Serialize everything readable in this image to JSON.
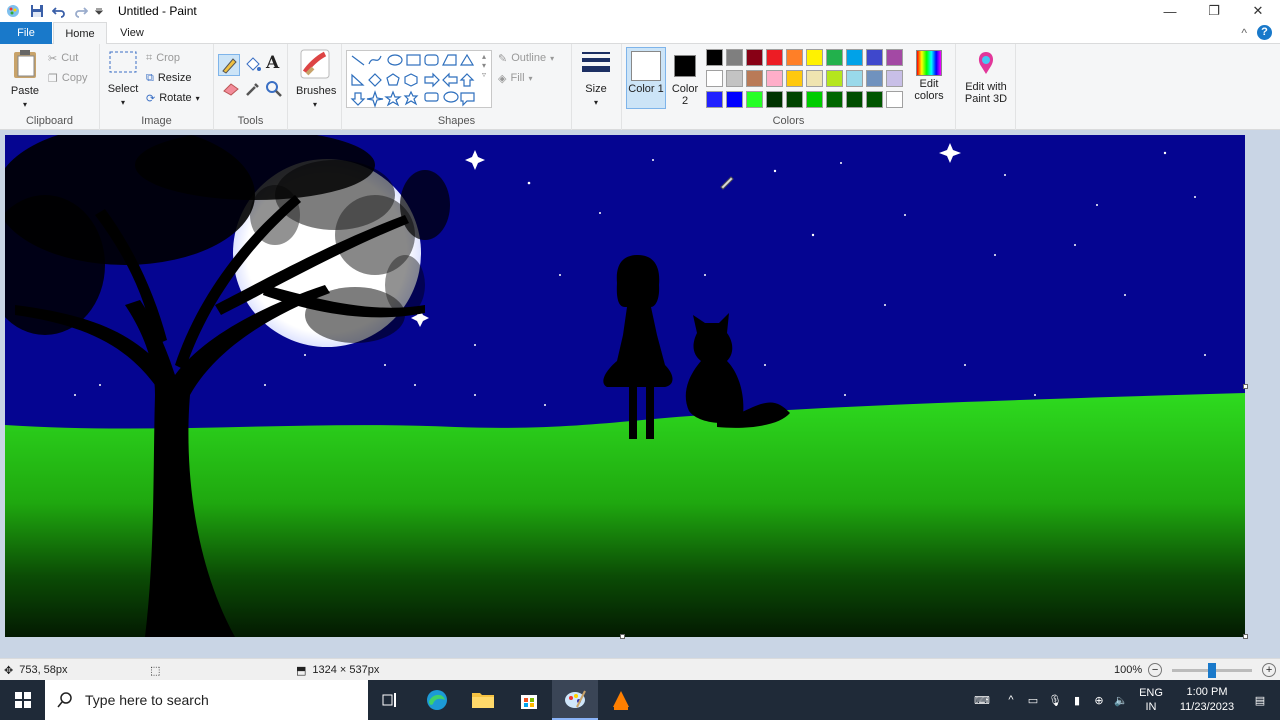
{
  "window": {
    "title": "Untitled - Paint",
    "minimize": "—",
    "restore": "❐",
    "close": "✕"
  },
  "tabs": {
    "file": "File",
    "home": "Home",
    "view": "View",
    "collapse": "^",
    "help": "?"
  },
  "ribbon": {
    "clipboard": {
      "label": "Clipboard",
      "paste": "Paste",
      "cut": "Cut",
      "copy": "Copy"
    },
    "image": {
      "label": "Image",
      "select": "Select",
      "crop": "Crop",
      "resize": "Resize",
      "rotate": "Rotate"
    },
    "tools": {
      "label": "Tools"
    },
    "brushes": {
      "label": "Brushes"
    },
    "shapes": {
      "label": "Shapes",
      "outline": "Outline",
      "fill": "Fill"
    },
    "size": {
      "label": "Size"
    },
    "colors": {
      "label": "Colors",
      "color1": "Color 1",
      "color2": "Color 2",
      "color1_value": "#ffffff",
      "color2_value": "#000000",
      "edit_colors": "Edit colors",
      "edit_3d": "Edit with Paint 3D",
      "palette_row1": [
        "#000000",
        "#7f7f7f",
        "#880015",
        "#ed1c24",
        "#ff7f27",
        "#fff200",
        "#22b14c",
        "#00a2e8",
        "#3f48cc",
        "#a349a4"
      ],
      "palette_row2": [
        "#ffffff",
        "#c3c3c3",
        "#b97a57",
        "#ffaec9",
        "#ffc90e",
        "#efe4b0",
        "#b5e61d",
        "#99d9ea",
        "#7092be",
        "#c8bfe7"
      ],
      "palette_row3": [
        "#2121ff",
        "#0000ff",
        "#26ff26",
        "#003300",
        "#004400",
        "#00cc00",
        "#006600",
        "#004d00",
        "#005500",
        "#ffffff"
      ]
    }
  },
  "status": {
    "cursor_pos": "753, 58px",
    "canvas_size": "1324 × 537px",
    "zoom": "100%"
  },
  "taskbar": {
    "search_placeholder": "Type here to search",
    "lang1": "ENG",
    "lang2": "IN",
    "time": "1:00 PM",
    "date": "11/23/2023"
  }
}
